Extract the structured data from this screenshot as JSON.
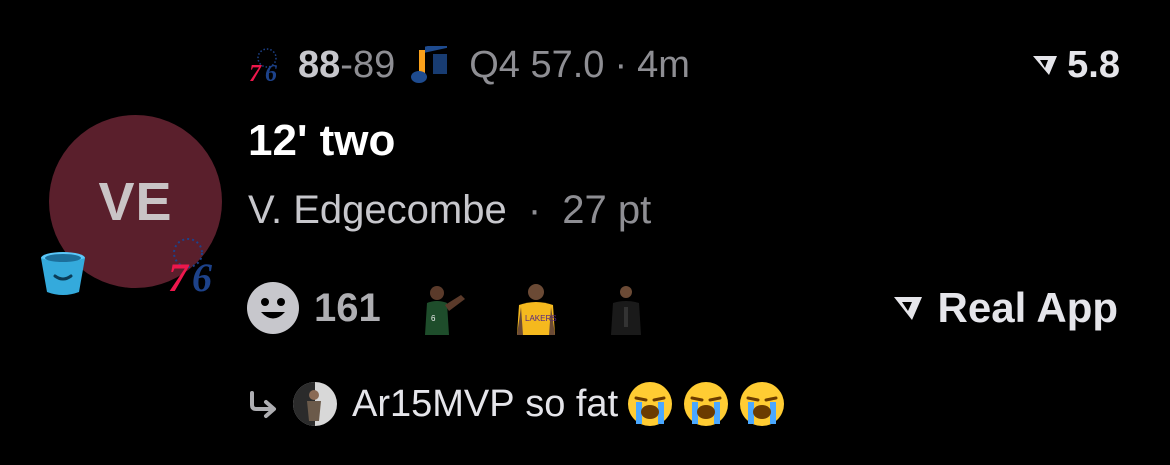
{
  "game": {
    "home_team_icon": "sixers-76-logo",
    "home_score": "88",
    "separator": "-",
    "away_score": "89",
    "away_team_icon": "jazz-note-logo",
    "clock": "Q4 57.0",
    "age": "4m",
    "dot": "·"
  },
  "metric": {
    "icon": "real-app-logo",
    "value": "5.8"
  },
  "play": {
    "title": "12' two",
    "player": "V. Edgecombe",
    "dot": "·",
    "points": "27 pt"
  },
  "avatar": {
    "initials": "VE",
    "color": "#5a1f2c",
    "bucket_icon": "bucket-emoji",
    "team_badge": "sixers-76-logo"
  },
  "reactions": {
    "icon": "smiley-icon",
    "count": "161"
  },
  "brand": {
    "label": "Real App",
    "icon": "real-app-logo"
  },
  "comment": {
    "icon": "reply-arrow-icon",
    "username": "Ar15MVP",
    "text": "so fat",
    "emojis": [
      "loudly-crying-face",
      "loudly-crying-face",
      "loudly-crying-face"
    ]
  }
}
